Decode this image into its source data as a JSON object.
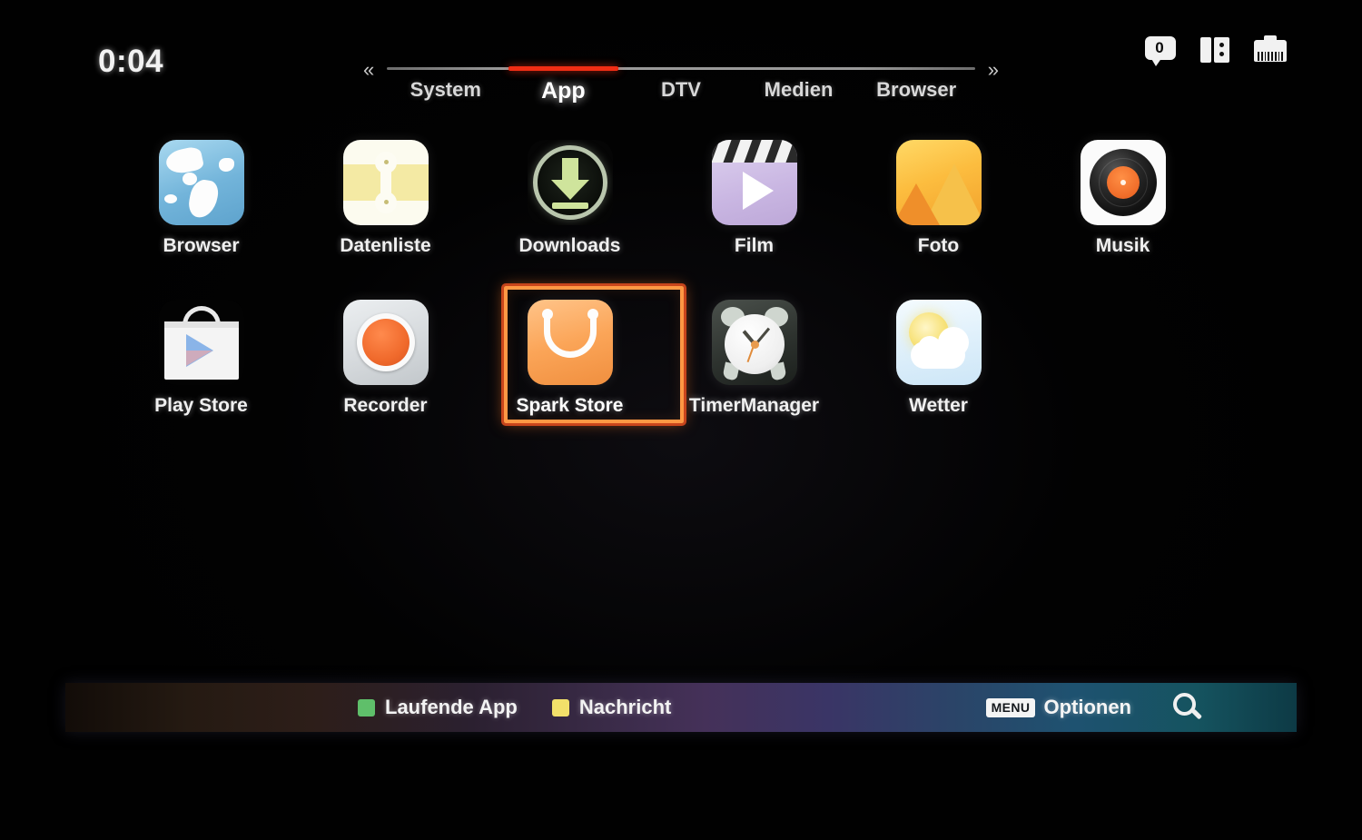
{
  "topbar": {
    "clock": "0:04",
    "status_icons": [
      {
        "name": "message-icon",
        "badge": "0"
      },
      {
        "name": "usb-storage-icon"
      },
      {
        "name": "ethernet-icon"
      }
    ]
  },
  "tabs": {
    "prev_label": "«",
    "next_label": "»",
    "active_index": 1,
    "active_color": "#f02d14",
    "items": [
      {
        "label": "System"
      },
      {
        "label": "App"
      },
      {
        "label": "DTV"
      },
      {
        "label": "Medien"
      },
      {
        "label": "Browser"
      }
    ]
  },
  "apps": {
    "rows": [
      [
        {
          "label": "Browser",
          "icon": "globe-icon",
          "selected": false
        },
        {
          "label": "Datenliste",
          "icon": "file-list-icon",
          "selected": false
        },
        {
          "label": "Downloads",
          "icon": "download-arrow-icon",
          "selected": false
        },
        {
          "label": "Film",
          "icon": "clapperboard-play-icon",
          "selected": false
        },
        {
          "label": "Foto",
          "icon": "photo-mountains-icon",
          "selected": false
        },
        {
          "label": "Musik",
          "icon": "vinyl-record-icon",
          "selected": false
        }
      ],
      [
        {
          "label": "Play Store",
          "icon": "shopping-bag-play-icon",
          "selected": false
        },
        {
          "label": "Recorder",
          "icon": "record-button-icon",
          "selected": false
        },
        {
          "label": "Spark Store",
          "icon": "spark-bag-icon",
          "selected": true
        },
        {
          "label": "TimerManager",
          "icon": "alarm-clock-icon",
          "selected": false
        },
        {
          "label": "Wetter",
          "icon": "sun-cloud-icon",
          "selected": false
        }
      ]
    ],
    "selection_color": "#ff9844"
  },
  "statusbar": {
    "legend": [
      {
        "label": "Laufende App",
        "color": "#5fbf6a"
      },
      {
        "label": "Nachricht",
        "color": "#f2e06a"
      }
    ],
    "menu_badge": "MENU",
    "menu_label": "Optionen",
    "search_icon": "search-icon"
  }
}
